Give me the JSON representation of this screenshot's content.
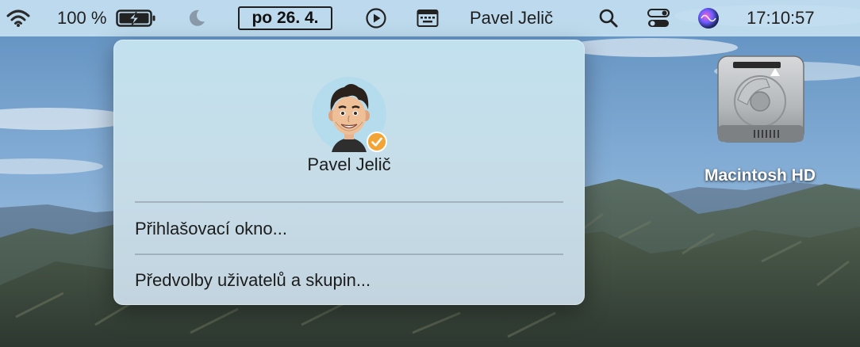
{
  "menubar": {
    "battery_percent": "100 %",
    "date": "po 26. 4.",
    "user_name": "Pavel Jelič",
    "time": "17:10:57",
    "icons": [
      "wifi-icon",
      "battery-charging-icon",
      "moon-icon",
      "play-circle-icon",
      "keyboard-viewer-icon",
      "search-icon",
      "control-center-icon",
      "siri-icon"
    ]
  },
  "user_menu": {
    "user_name": "Pavel Jelič",
    "items": [
      {
        "label": "Přihlašovací okno..."
      },
      {
        "label": "Předvolby uživatelů a skupin..."
      }
    ],
    "badge_color": "#f0a030"
  },
  "desktop": {
    "drive_label": "Macintosh HD"
  }
}
